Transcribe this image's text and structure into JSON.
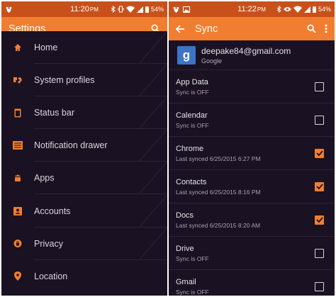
{
  "left_screen": {
    "status": {
      "time": "11:20",
      "am_pm": "PM",
      "battery": "54%"
    },
    "appbar": {
      "title": "Settings"
    },
    "items": [
      {
        "label": "Home",
        "icon": "home-icon"
      },
      {
        "label": "System profiles",
        "icon": "profiles-icon"
      },
      {
        "label": "Status bar",
        "icon": "status-bar-icon"
      },
      {
        "label": "Notification drawer",
        "icon": "notification-drawer-icon"
      },
      {
        "label": "Apps",
        "icon": "android-icon"
      },
      {
        "label": "Accounts",
        "icon": "account-icon"
      },
      {
        "label": "Privacy",
        "icon": "privacy-icon"
      },
      {
        "label": "Location",
        "icon": "location-icon"
      }
    ]
  },
  "right_screen": {
    "status": {
      "time": "11:22",
      "am_pm": "PM",
      "battery": "54%"
    },
    "appbar": {
      "title": "Sync"
    },
    "account": {
      "email": "deepake84@gmail.com",
      "provider": "Google",
      "logo": "g"
    },
    "items": [
      {
        "name": "App Data",
        "status": "Sync is OFF",
        "checked": false
      },
      {
        "name": "Calendar",
        "status": "Sync is OFF",
        "checked": false
      },
      {
        "name": "Chrome",
        "status": "Last synced 6/25/2015 6:27 PM",
        "checked": true
      },
      {
        "name": "Contacts",
        "status": "Last synced 6/25/2015 8:16 PM",
        "checked": true
      },
      {
        "name": "Docs",
        "status": "Last synced 6/25/2015 8:20 AM",
        "checked": true
      },
      {
        "name": "Drive",
        "status": "Sync is OFF",
        "checked": false
      },
      {
        "name": "Gmail",
        "status": "Sync is OFF",
        "checked": false
      }
    ]
  },
  "colors": {
    "accent": "#f17e30",
    "statusbar": "#c8511b",
    "background": "#1a1223"
  }
}
